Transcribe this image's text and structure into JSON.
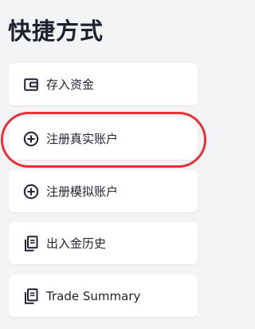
{
  "page": {
    "title": "快捷方式"
  },
  "shortcuts": [
    {
      "label": "存入资金",
      "icon": "wallet-icon"
    },
    {
      "label": "注册真实账户",
      "icon": "add-circle-icon"
    },
    {
      "label": "注册模拟账户",
      "icon": "add-circle-icon"
    },
    {
      "label": "出入金历史",
      "icon": "documents-icon"
    },
    {
      "label": "Trade Summary",
      "icon": "documents-icon"
    }
  ],
  "annotation": {
    "highlight_color": "#e8323a",
    "highlighted_item": "注册真实账户"
  }
}
